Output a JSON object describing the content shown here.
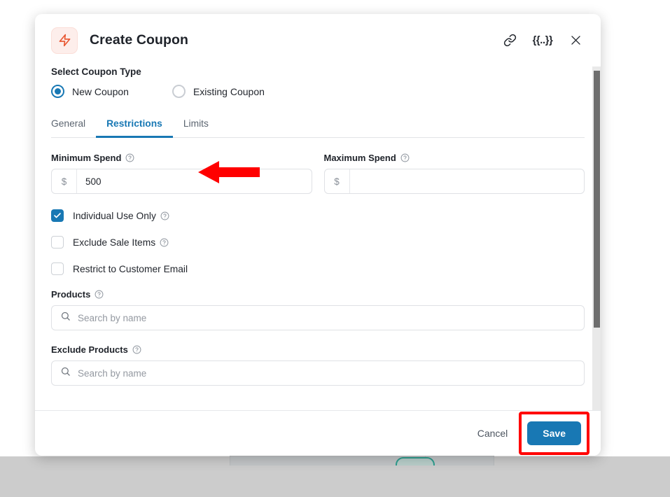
{
  "modal": {
    "title": "Create Coupon",
    "brand_icon": "lightning-bolt-icon",
    "header_actions": [
      {
        "name": "copy-link-icon",
        "label": ""
      },
      {
        "name": "merge-tag-icon",
        "label": "{{..}}"
      },
      {
        "name": "close-icon",
        "label": ""
      }
    ]
  },
  "coupon_type": {
    "section_label": "Select Coupon Type",
    "options": [
      {
        "label": "New Coupon",
        "selected": true
      },
      {
        "label": "Existing Coupon",
        "selected": false
      }
    ]
  },
  "tabs": [
    {
      "label": "General",
      "active": false
    },
    {
      "label": "Restrictions",
      "active": true
    },
    {
      "label": "Limits",
      "active": false
    }
  ],
  "fields": {
    "minimum_spend": {
      "label": "Minimum Spend",
      "prefix": "$",
      "value": "500",
      "placeholder": "",
      "has_help": true
    },
    "maximum_spend": {
      "label": "Maximum Spend",
      "prefix": "$",
      "value": "",
      "placeholder": "",
      "has_help": true
    }
  },
  "checkboxes": [
    {
      "label": "Individual Use Only",
      "checked": true,
      "has_help": true
    },
    {
      "label": "Exclude Sale Items",
      "checked": false,
      "has_help": true
    },
    {
      "label": "Restrict to Customer Email",
      "checked": false,
      "has_help": false
    }
  ],
  "search_fields": [
    {
      "label": "Products",
      "placeholder": "Search by name",
      "value": "",
      "has_help": true
    },
    {
      "label": "Exclude Products",
      "placeholder": "Search by name",
      "value": "",
      "has_help": true
    }
  ],
  "footer": {
    "cancel_label": "Cancel",
    "save_label": "Save"
  },
  "colors": {
    "accent_blue": "#1878b4",
    "brand_icon_bg": "#fdeeeb",
    "brand_icon_fg": "#e8552f",
    "annotation_red": "#ff0000",
    "page_background": "#cccccc"
  },
  "annotations": [
    {
      "name": "arrow-pointing-to-minimum-spend",
      "type": "arrow-left",
      "color": "#ff0000"
    },
    {
      "name": "highlight-box-around-save",
      "type": "rectangle",
      "color": "#ff0000"
    }
  ]
}
